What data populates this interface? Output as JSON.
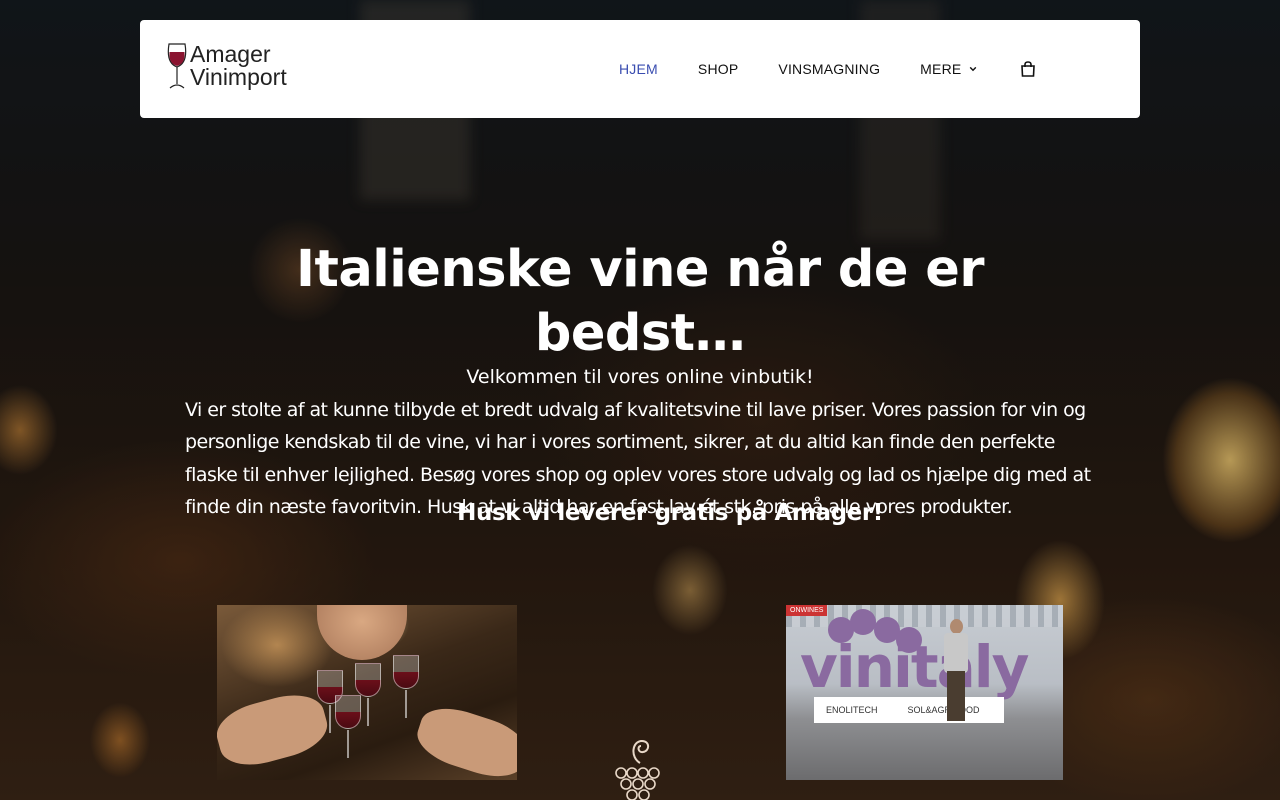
{
  "logo": {
    "line1": "Amager",
    "line2": "Vinimport"
  },
  "nav": {
    "items": [
      {
        "label": "HJEM",
        "active": true
      },
      {
        "label": "SHOP",
        "active": false
      },
      {
        "label": "VINSMAGNING",
        "active": false
      },
      {
        "label": "MERE",
        "active": false
      }
    ],
    "cart_icon": "shopping-bag-icon",
    "dropdown_icon": "chevron-down-icon",
    "active_color": "#3a4db0"
  },
  "hero": {
    "title": "Italienske vine når de er bedst…",
    "subtitle": "Velkommen til vores online vinbutik!",
    "paragraph": "Vi er stolte af at kunne tilbyde et bredt udvalg af kvalitetsvine til lave priser. Vores passion for vin og personlige kendskab til de vine, vi har i vores sortiment, sikrer, at du altid kan finde den perfekte flaske til enhver lejlighed. Besøg vores shop og oplev vores store udvalg og lad os hjælpe dig med at finde din næste favoritvin. Husk at vi altid har en fast lav ét stk. pris på alle vores produkter.",
    "delivery_note": "Husk vi leverer gratis på Amager!"
  },
  "images": {
    "left_alt": "Friends toasting with red wine",
    "right_sign_text": "vinitaly",
    "right_banner_1": "ENOLITECH",
    "right_banner_2": "SOL&AGRIFOOD",
    "right_tag": "ONWINES"
  },
  "decor": {
    "grape_icon": "grape-cluster-icon"
  }
}
